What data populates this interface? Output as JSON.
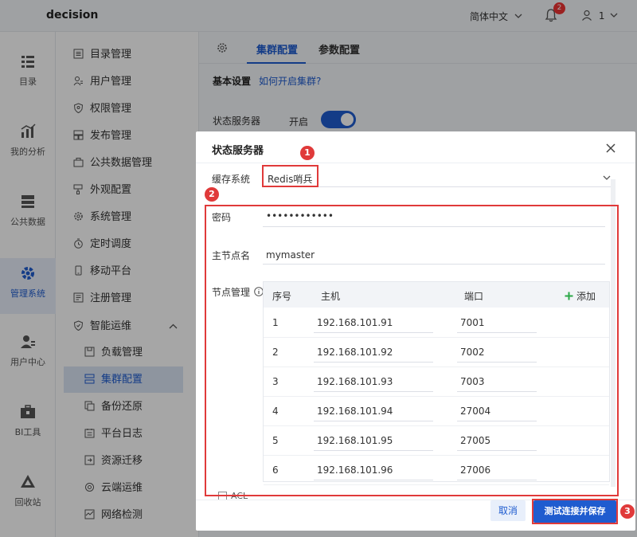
{
  "header": {
    "logo": "decision",
    "language": "简体中文",
    "notification_count": "2",
    "user": "1"
  },
  "leftnav": [
    {
      "label": "目录",
      "icon": "directory-icon"
    },
    {
      "label": "我的分析",
      "icon": "analysis-icon"
    },
    {
      "label": "公共数据",
      "icon": "public-data-icon"
    },
    {
      "label": "管理系统",
      "icon": "management-gear-icon"
    },
    {
      "label": "用户中心",
      "icon": "user-center-icon"
    },
    {
      "label": "BI工具",
      "icon": "bi-tools-icon"
    },
    {
      "label": "回收站",
      "icon": "recycle-icon"
    }
  ],
  "midnav": {
    "items": [
      "目录管理",
      "用户管理",
      "权限管理",
      "发布管理",
      "公共数据管理",
      "外观配置",
      "系统管理",
      "定时调度",
      "移动平台",
      "注册管理",
      "智能运维"
    ],
    "sub_items": [
      "负载管理",
      "集群配置",
      "备份还原",
      "平台日志",
      "资源迁移",
      "云端运维",
      "网络检测"
    ]
  },
  "main": {
    "tabs": [
      "集群配置",
      "参数配置"
    ],
    "basic_settings": "基本设置",
    "how_to_link": "如何开启集群?",
    "state_server_label": "状态服务器",
    "state_server_value": "开启"
  },
  "modal": {
    "title": "状态服务器",
    "cache_label": "缓存系统",
    "cache_value": "Redis哨兵",
    "password_label": "密码",
    "password_value": "••••••••••••",
    "master_label": "主节点名",
    "master_value": "mymaster",
    "nodes_label": "节点管理",
    "table": {
      "headers": [
        "序号",
        "主机",
        "端口"
      ],
      "add_label": "添加",
      "rows": [
        {
          "idx": "1",
          "host": "192.168.101.91",
          "port": "7001"
        },
        {
          "idx": "2",
          "host": "192.168.101.92",
          "port": "7002"
        },
        {
          "idx": "3",
          "host": "192.168.101.93",
          "port": "7003"
        },
        {
          "idx": "4",
          "host": "192.168.101.94",
          "port": "27004"
        },
        {
          "idx": "5",
          "host": "192.168.101.95",
          "port": "27005"
        },
        {
          "idx": "6",
          "host": "192.168.101.96",
          "port": "27006"
        }
      ]
    },
    "acl_label": "ACL",
    "cancel_label": "取消",
    "save_label": "测试连接并保存"
  },
  "annotations": [
    "1",
    "2",
    "3"
  ],
  "colors": {
    "accent": "#1f5ccf",
    "annotation_red": "#e03a3a"
  }
}
